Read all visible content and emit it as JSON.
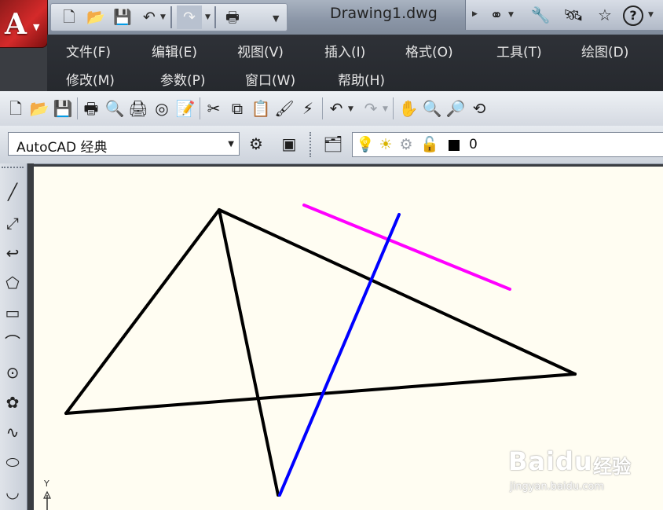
{
  "app": {
    "logo_letter": "A",
    "document_title": "Drawing1.dwg"
  },
  "quick_access": {
    "icons": [
      "new-file-icon",
      "open-folder-icon",
      "save-icon",
      "undo-icon",
      "redo-icon",
      "plot-icon"
    ]
  },
  "info_center": {
    "icons": [
      "binoculars-icon",
      "wrench-icon",
      "satellite-icon",
      "star-icon",
      "help-icon"
    ],
    "help_glyph": "?"
  },
  "menubar": {
    "row1": [
      "文件(F)",
      "编辑(E)",
      "视图(V)",
      "插入(I)",
      "格式(O)",
      "工具(T)",
      "绘图(D)"
    ],
    "row2": [
      "修改(M)",
      "参数(P)",
      "窗口(W)",
      "帮助(H)"
    ]
  },
  "workspaces": {
    "selected": "AutoCAD 经典"
  },
  "layers": {
    "current": "0"
  },
  "draw_tools": [
    "line-icon",
    "construction-line-icon",
    "polyline-icon",
    "polygon-icon",
    "rectangle-icon",
    "arc-icon",
    "circle-icon",
    "revision-cloud-icon",
    "spline-icon",
    "ellipse-icon",
    "ellipse-arc-icon"
  ],
  "ucs": {
    "y_label": "Y"
  },
  "drawing": {
    "colors": {
      "black": "#000000",
      "magenta": "#ff00ff",
      "blue": "#0000ff",
      "canvas": "#fffdf2"
    }
  },
  "watermark": {
    "brand": "Baidu",
    "brand_cn": "经验",
    "url": "jingyan.baidu.com"
  }
}
